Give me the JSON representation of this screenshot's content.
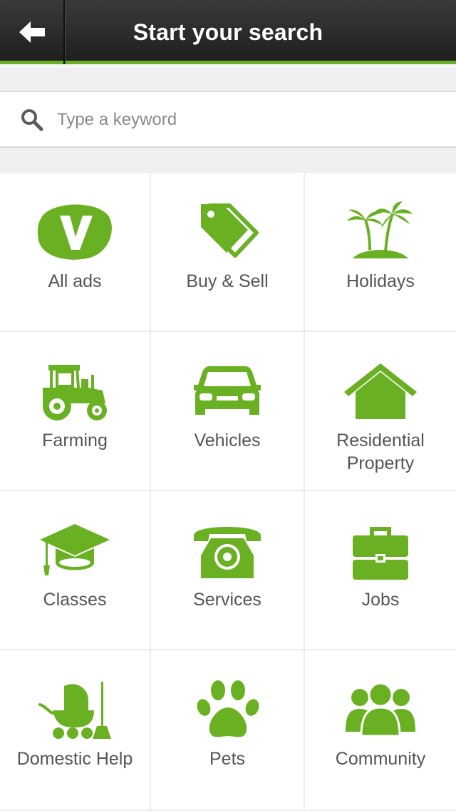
{
  "header": {
    "title": "Start your search",
    "back_icon": "back-arrow-icon"
  },
  "search": {
    "placeholder": "Type a keyword",
    "value": "",
    "icon": "search-icon"
  },
  "colors": {
    "accent": "#6ab023",
    "nav_bg": "#2a2a2a",
    "label": "#555555"
  },
  "categories": [
    {
      "label": "All ads",
      "icon": "all-ads-logo-icon"
    },
    {
      "label": "Buy & Sell",
      "icon": "price-tags-icon"
    },
    {
      "label": "Holidays",
      "icon": "palm-island-icon"
    },
    {
      "label": "Farming",
      "icon": "tractor-icon"
    },
    {
      "label": "Vehicles",
      "icon": "car-icon"
    },
    {
      "label": "Residential Property",
      "icon": "house-icon"
    },
    {
      "label": "Classes",
      "icon": "graduation-cap-icon"
    },
    {
      "label": "Services",
      "icon": "telephone-icon"
    },
    {
      "label": "Jobs",
      "icon": "briefcase-icon"
    },
    {
      "label": "Domestic Help",
      "icon": "pram-broom-icon"
    },
    {
      "label": "Pets",
      "icon": "paw-icon"
    },
    {
      "label": "Community",
      "icon": "people-group-icon"
    }
  ]
}
